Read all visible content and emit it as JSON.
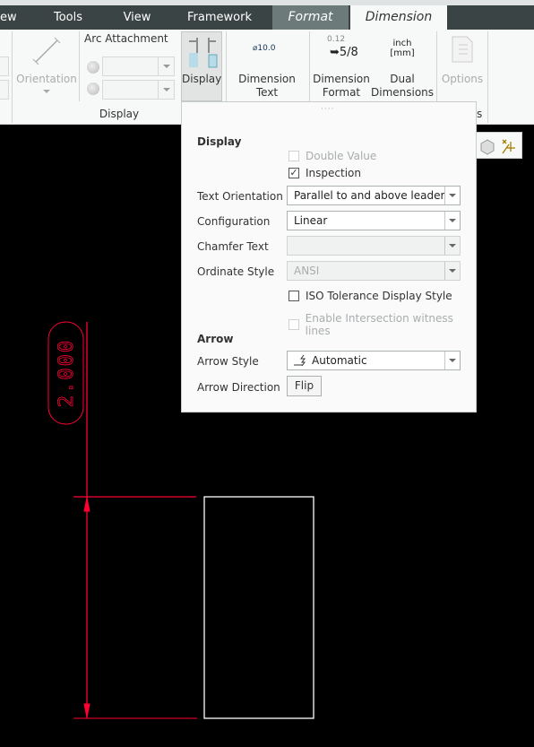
{
  "tabs": [
    {
      "label": "ew"
    },
    {
      "label": "Tools"
    },
    {
      "label": "View"
    },
    {
      "label": "Framework"
    },
    {
      "label": "Format"
    },
    {
      "label": "Dimension"
    }
  ],
  "ribbon": {
    "orientation_label": "Orientation",
    "arc_attachment_label": "Arc Attachment",
    "display_button_label": "Display",
    "display_group_label": "Display",
    "dimension_text_label": [
      "Dimension",
      "Text"
    ],
    "dimension_text_icon_text": "⌀10.0",
    "dimension_format_label": [
      "Dimension",
      "Format"
    ],
    "dimension_format_icon_text": "0.12",
    "dimension_format_fraction": "5/8",
    "dual_dimensions_label": [
      "Dual",
      "Dimensions"
    ],
    "dual_icon_text": [
      "inch",
      "[mm]"
    ],
    "options_label": "Options",
    "group_label_partial": "s"
  },
  "panel": {
    "display_heading": "Display",
    "double_value": {
      "label": "Double Value",
      "checked": false,
      "enabled": false
    },
    "inspection": {
      "label": "Inspection",
      "checked": true,
      "enabled": true
    },
    "text_orientation": {
      "label": "Text Orientation",
      "value": "Parallel to and above leader"
    },
    "configuration": {
      "label": "Configuration",
      "value": "Linear"
    },
    "chamfer_text": {
      "label": "Chamfer Text",
      "value": ""
    },
    "ordinate_style": {
      "label": "Ordinate Style",
      "value": "ANSI"
    },
    "iso_tolerance": {
      "label": "ISO Tolerance Display Style",
      "checked": false
    },
    "intersection_witness": {
      "label": "Enable Intersection witness lines",
      "checked": false,
      "enabled": false
    },
    "arrow_heading": "Arrow",
    "arrow_style": {
      "label": "Arrow Style",
      "value": "Automatic"
    },
    "arrow_direction": {
      "label": "Arrow Direction",
      "button": "Flip"
    }
  },
  "drawing": {
    "dimension_value": "2.000",
    "dimension_color": "#ff0033"
  }
}
